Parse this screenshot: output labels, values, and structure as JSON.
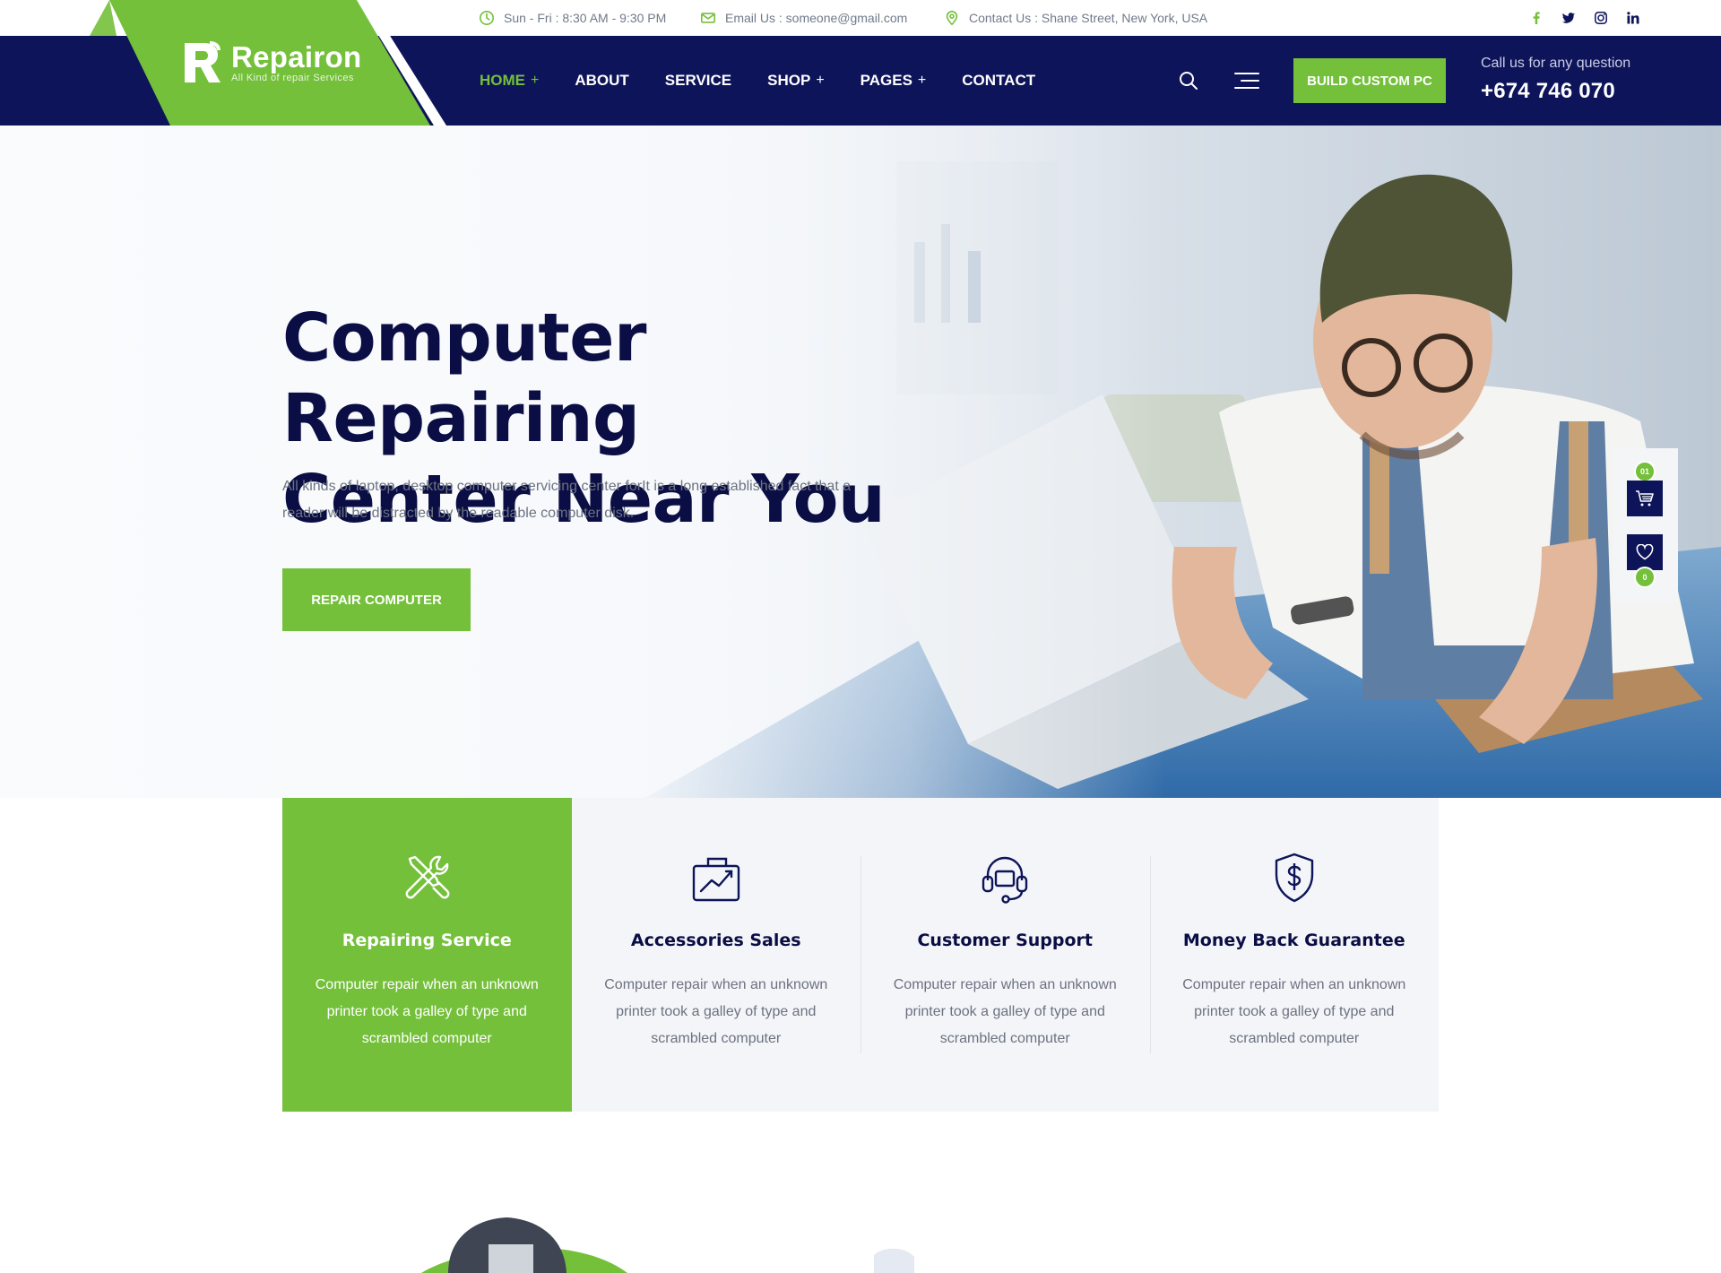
{
  "topbar": {
    "hours": "Sun - Fri : 8:30 AM - 9:30 PM",
    "email": "Email Us : someone@gmail.com",
    "address": "Contact Us : Shane Street, New York, USA",
    "socials": [
      "facebook-icon",
      "twitter-icon",
      "instagram-icon",
      "linkedin-icon"
    ]
  },
  "brand": {
    "name": "Repairon",
    "tagline": "All Kind of repair Services",
    "accent": "#74c03a",
    "navy": "#0d1459"
  },
  "nav": {
    "items": [
      {
        "label": "HOME",
        "has_submenu": true,
        "active": true
      },
      {
        "label": "ABOUT",
        "has_submenu": false
      },
      {
        "label": "SERVICE",
        "has_submenu": false
      },
      {
        "label": "SHOP",
        "has_submenu": true
      },
      {
        "label": "PAGES",
        "has_submenu": true
      },
      {
        "label": "CONTACT",
        "has_submenu": false
      }
    ],
    "build_button": "BUILD CUSTOM PC",
    "call_label": "Call us for any question",
    "call_number": "+674 746 070"
  },
  "hero": {
    "title_line1": "Computer Repairing",
    "title_line2": "Center Near You",
    "description": "All kinds of laptop, desktop computer servicing center forIt is a long established fact that a reader will be distracted by the readable computer disk.",
    "button": "REPAIR COMPUTER"
  },
  "side_widget": {
    "cart_count": "01",
    "wishlist_count": "0"
  },
  "features": [
    {
      "icon": "tools-icon",
      "title": "Repairing Service",
      "text": "Computer repair when an unknown printer took a galley of type and scrambled computer",
      "active": true
    },
    {
      "icon": "chart-box-icon",
      "title": "Accessories Sales",
      "text": "Computer repair when an unknown printer took a galley of type and scrambled computer",
      "active": false
    },
    {
      "icon": "headset-icon",
      "title": "Customer Support",
      "text": "Computer repair when an unknown printer took a galley of type and scrambled computer",
      "active": false
    },
    {
      "icon": "shield-dollar-icon",
      "title": "Money Back Guarantee",
      "text": "Computer repair when an unknown printer took a galley of type and scrambled computer",
      "active": false
    }
  ]
}
